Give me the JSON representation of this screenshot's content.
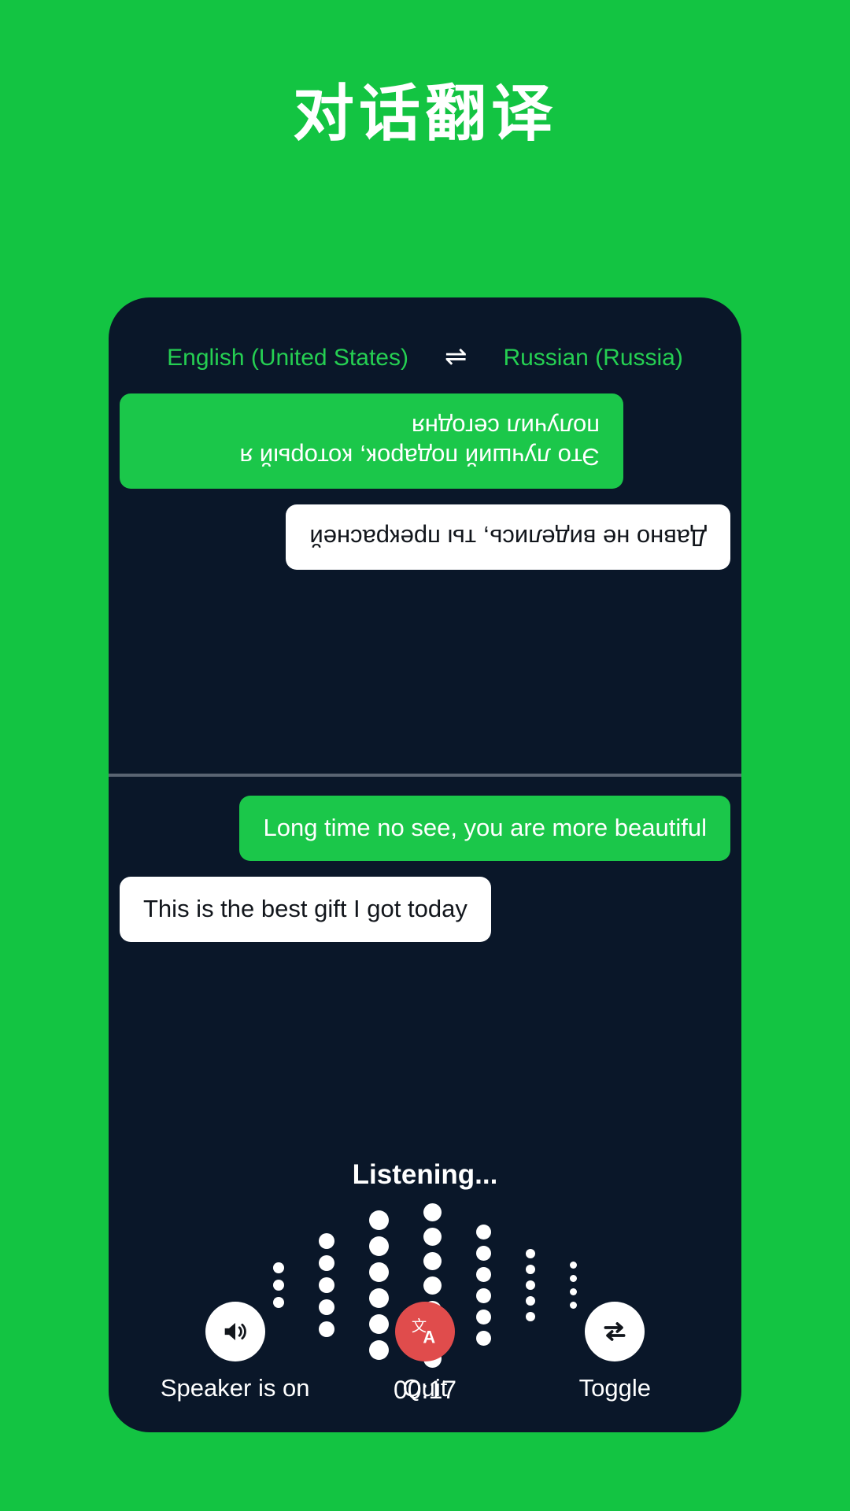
{
  "page": {
    "title": "对话翻译",
    "background_color": "#13c442",
    "panel_color": "#0a1729",
    "accent_green": "#1bc74a",
    "lang_text_color": "#25cf52",
    "quit_color": "#e04c4c"
  },
  "language_bar": {
    "source": "English (United States)",
    "swap_icon": "⇌",
    "target": "Russian (Russia)"
  },
  "conversation": {
    "top_panel_rotated": true,
    "top_messages": [
      {
        "text": "Это лучший подарок, который я получил сегодня",
        "style": "green",
        "align": "right"
      },
      {
        "text": "Давно не виделись, ты прекрасней",
        "style": "white",
        "align": "left"
      }
    ],
    "bottom_messages": [
      {
        "text": "Long time no see, you are more beautiful",
        "style": "green",
        "align": "right"
      },
      {
        "text": "This is the best gift I got today",
        "style": "white",
        "align": "left"
      }
    ]
  },
  "status": {
    "listening_label": "Listening...",
    "timer": "00:17"
  },
  "waveform": {
    "columns": [
      {
        "count": 3,
        "size": 14
      },
      {
        "count": 5,
        "size": 20
      },
      {
        "count": 6,
        "size": 25
      },
      {
        "count": 7,
        "size": 23
      },
      {
        "count": 6,
        "size": 19
      },
      {
        "count": 5,
        "size": 12
      },
      {
        "count": 4,
        "size": 9
      }
    ]
  },
  "controls": [
    {
      "label": "Speaker is on",
      "icon": "speaker-on-icon",
      "circle": "white"
    },
    {
      "label": "Quit",
      "icon": "translate-icon",
      "circle": "red"
    },
    {
      "label": "Toggle",
      "icon": "swap-arrows-icon",
      "circle": "white"
    }
  ]
}
